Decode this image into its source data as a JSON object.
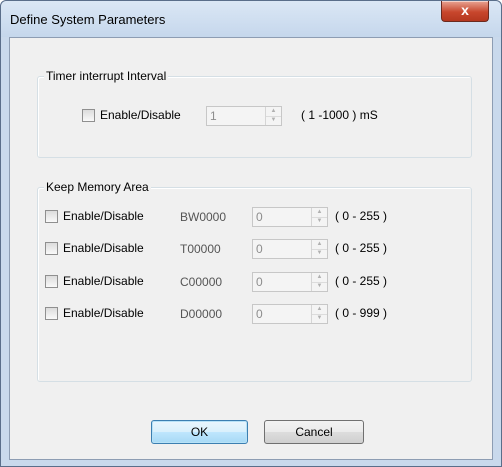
{
  "window": {
    "title": "Define System Parameters",
    "close_glyph": "x"
  },
  "timer_group": {
    "legend": "Timer interrupt Interval",
    "enable_label": "Enable/Disable",
    "value": "1",
    "range": "( 1 -1000 ) mS"
  },
  "memory_group": {
    "legend": "Keep Memory Area",
    "rows": [
      {
        "enable_label": "Enable/Disable",
        "address": "BW0000",
        "value": "0",
        "range": "( 0 - 255 )"
      },
      {
        "enable_label": "Enable/Disable",
        "address": "T00000",
        "value": "0",
        "range": "( 0 - 255 )"
      },
      {
        "enable_label": "Enable/Disable",
        "address": "C00000",
        "value": "0",
        "range": "( 0 - 255 )"
      },
      {
        "enable_label": "Enable/Disable",
        "address": "D00000",
        "value": "0",
        "range": "( 0 - 999 )"
      }
    ]
  },
  "buttons": {
    "ok": "OK",
    "cancel": "Cancel"
  }
}
